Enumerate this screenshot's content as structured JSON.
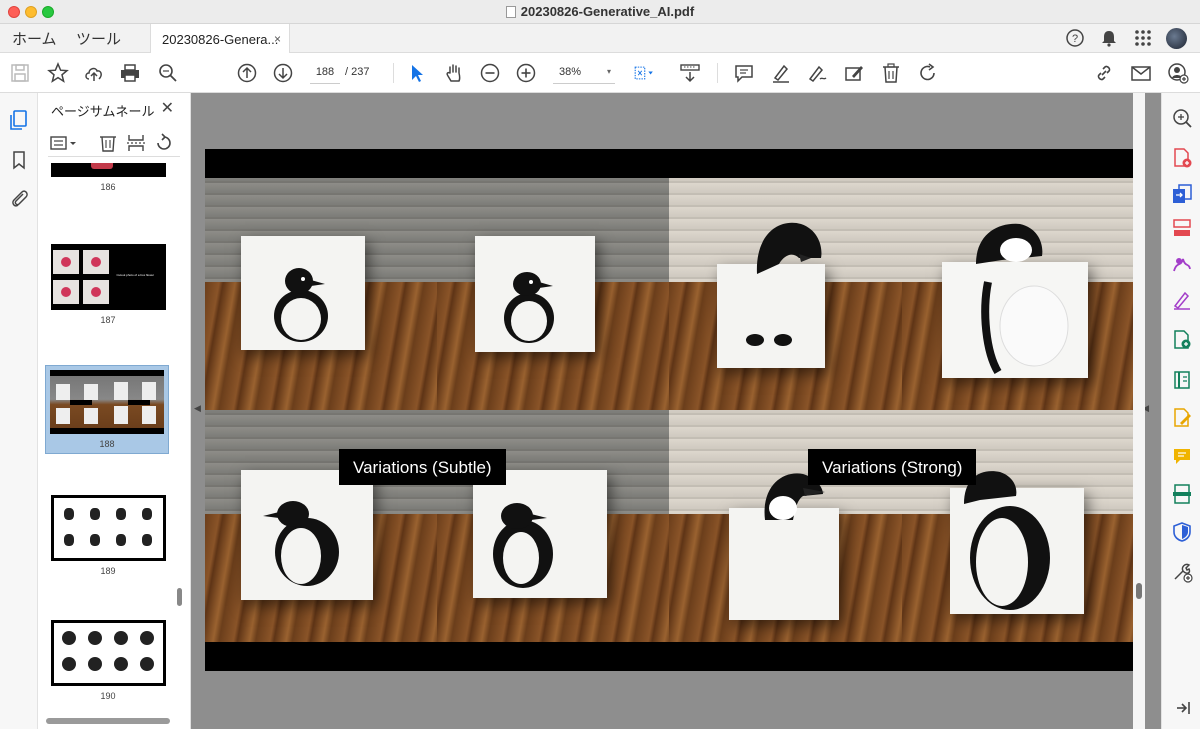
{
  "window": {
    "title": "20230826-Generative_AI.pdf"
  },
  "menu": {
    "home": "ホーム",
    "tools": "ツール"
  },
  "tab": {
    "label": "20230826-Genera...",
    "close": "×"
  },
  "toolbar": {
    "page_current": "188",
    "page_total": "/ 237",
    "zoom": "38%",
    "zoom_arrow": "▾"
  },
  "panel": {
    "title": "ページサムネール",
    "close": "✕",
    "thumbnails": [
      {
        "page": "186"
      },
      {
        "page": "187",
        "caption": "Cutout photo of a box flower"
      },
      {
        "page": "188",
        "selected": true
      },
      {
        "page": "189"
      },
      {
        "page": "190"
      }
    ]
  },
  "document": {
    "label_left": "Variations (Subtle)",
    "label_right": "Variations (Strong)"
  },
  "view": {
    "collapse_left": "◀",
    "collapse_right": "◀"
  },
  "colors": {
    "accent": "#1473e6",
    "selected_thumb": "#a9c8e6"
  }
}
